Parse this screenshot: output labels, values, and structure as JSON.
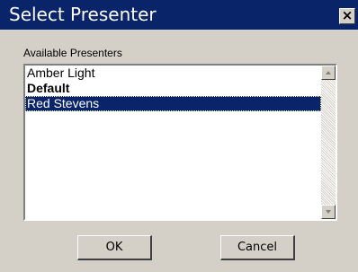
{
  "window": {
    "title": "Select Presenter",
    "close_glyph": "×"
  },
  "list": {
    "label": "Available Presenters",
    "items": [
      {
        "label": "Amber Light",
        "bold": false,
        "selected": false
      },
      {
        "label": "Default",
        "bold": true,
        "selected": false
      },
      {
        "label": "Red Stevens",
        "bold": false,
        "selected": true
      }
    ]
  },
  "buttons": {
    "ok_label": "OK",
    "cancel_label": "Cancel"
  },
  "icons": {
    "close": "close-icon",
    "scroll_up": "scroll-up-arrow-icon",
    "scroll_down": "scroll-down-arrow-icon"
  },
  "colors": {
    "titlebar": "#0a246a",
    "dialog_bg": "#d4d0c8",
    "selection": "#0a246a"
  }
}
